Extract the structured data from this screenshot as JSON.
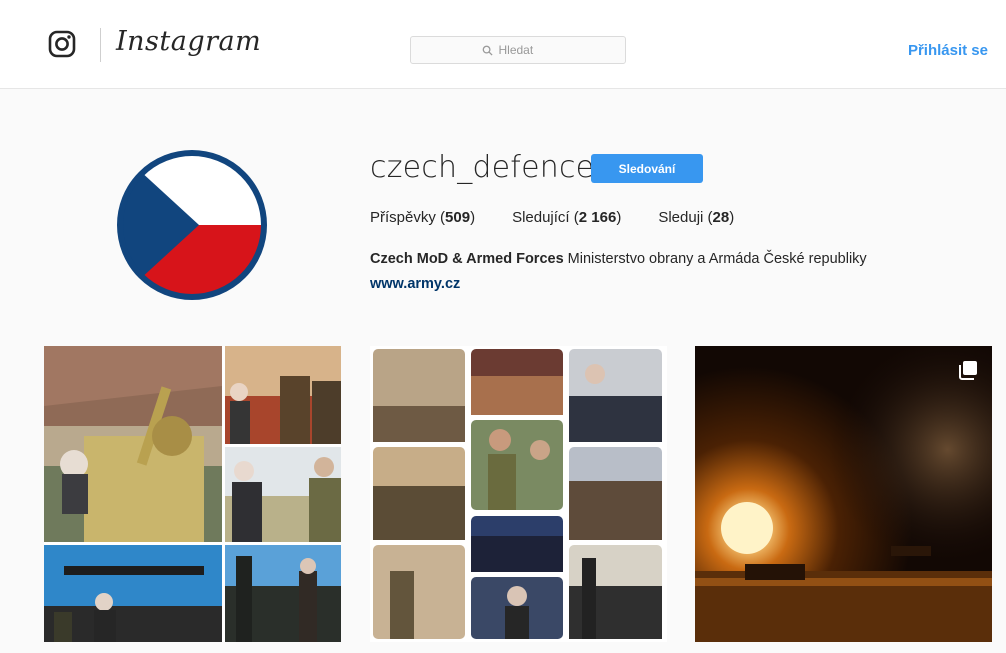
{
  "header": {
    "brand": "Instagram",
    "search": {
      "placeholder": "Hledat"
    },
    "login_label": "Přihlásit se"
  },
  "profile": {
    "username": "czech_defence",
    "follow_label": "Sledování",
    "stats": [
      {
        "label": "Příspěvky",
        "value": "509"
      },
      {
        "label": "Sledující",
        "value": "2 166"
      },
      {
        "label": "Sleduji",
        "value": "28"
      }
    ],
    "bio_name": "Czech MoD & Armed Forces",
    "bio_text": "Ministerstvo obrany a Armáda České republiky",
    "website": "www.army.cz",
    "avatar_colors": {
      "white": "#ffffff",
      "red": "#d7141a",
      "blue": "#11457e"
    }
  },
  "posts": [
    {
      "kind": "collage",
      "icon": "military-collage"
    },
    {
      "kind": "collage",
      "icon": "photo-grid-collage"
    },
    {
      "kind": "multi-photo",
      "icon": "night-fire-photo"
    }
  ],
  "colors": {
    "accent": "#3897f0",
    "link": "#003569"
  }
}
